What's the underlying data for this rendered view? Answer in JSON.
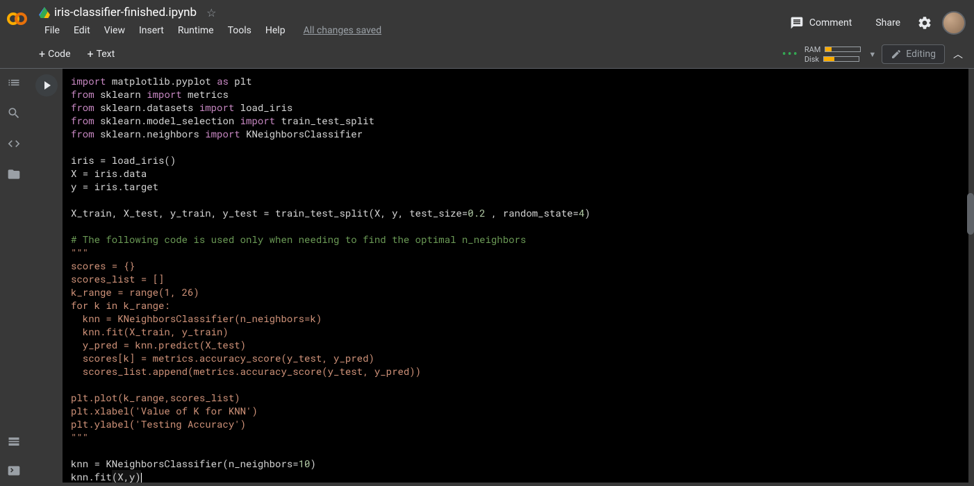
{
  "header": {
    "filename": "iris-classifier-finished.ipynb",
    "menu": {
      "file": "File",
      "edit": "Edit",
      "view": "View",
      "insert": "Insert",
      "runtime": "Runtime",
      "tools": "Tools",
      "help": "Help",
      "saved": "All changes saved"
    },
    "comment": "Comment",
    "share": "Share"
  },
  "toolbar": {
    "code": "Code",
    "text": "Text",
    "ram": "RAM",
    "disk": "Disk",
    "editing": "Editing"
  },
  "resources": {
    "ram_pct": 18,
    "disk_pct": 30
  },
  "code": {
    "lines": [
      {
        "t": "import",
        "k": "kw"
      },
      {
        "t": " matplotlib.pyplot "
      },
      {
        "t": "as",
        "k": "kw"
      },
      {
        "t": " plt"
      },
      {
        "br": true
      },
      {
        "t": "from",
        "k": "kw"
      },
      {
        "t": " sklearn "
      },
      {
        "t": "import",
        "k": "kw"
      },
      {
        "t": " metrics"
      },
      {
        "br": true
      },
      {
        "t": "from",
        "k": "kw"
      },
      {
        "t": " sklearn.datasets "
      },
      {
        "t": "import",
        "k": "kw"
      },
      {
        "t": " load_iris"
      },
      {
        "br": true
      },
      {
        "t": "from",
        "k": "kw"
      },
      {
        "t": " sklearn.model_selection "
      },
      {
        "t": "import",
        "k": "kw"
      },
      {
        "t": " train_test_split"
      },
      {
        "br": true
      },
      {
        "t": "from",
        "k": "kw"
      },
      {
        "t": " sklearn.neighbors "
      },
      {
        "t": "import",
        "k": "kw"
      },
      {
        "t": " KNeighborsClassifier"
      },
      {
        "br": true
      },
      {
        "br": true
      },
      {
        "t": "iris = load_iris()"
      },
      {
        "br": true
      },
      {
        "t": "X = iris.data"
      },
      {
        "br": true
      },
      {
        "t": "y = iris.target"
      },
      {
        "br": true
      },
      {
        "br": true
      },
      {
        "t": "X_train, X_test, y_train, y_test = train_test_split(X, y, test_size="
      },
      {
        "t": "0.2",
        "k": "num"
      },
      {
        "t": " , random_state="
      },
      {
        "t": "4",
        "k": "num"
      },
      {
        "t": ")"
      },
      {
        "br": true
      },
      {
        "br": true
      },
      {
        "t": "# The following code is used only when needing to find the optimal n_neighbors",
        "k": "comment"
      },
      {
        "br": true
      },
      {
        "t": "\"\"\"",
        "k": "str"
      },
      {
        "br": true
      },
      {
        "t": "scores = {}",
        "k": "str"
      },
      {
        "br": true
      },
      {
        "t": "scores_list = []",
        "k": "str"
      },
      {
        "br": true
      },
      {
        "t": "k_range = range(1, 26)",
        "k": "str"
      },
      {
        "br": true
      },
      {
        "t": "for k in k_range:",
        "k": "str"
      },
      {
        "br": true
      },
      {
        "t": "  knn = KNeighborsClassifier(n_neighbors=k)",
        "k": "str"
      },
      {
        "br": true
      },
      {
        "t": "  knn.fit(X_train, y_train)",
        "k": "str"
      },
      {
        "br": true
      },
      {
        "t": "  y_pred = knn.predict(X_test)",
        "k": "str"
      },
      {
        "br": true
      },
      {
        "t": "  scores[k] = metrics.accuracy_score(y_test, y_pred)",
        "k": "str"
      },
      {
        "br": true
      },
      {
        "t": "  scores_list.append(metrics.accuracy_score(y_test, y_pred))",
        "k": "str"
      },
      {
        "br": true
      },
      {
        "br": true
      },
      {
        "t": "plt.plot(k_range,scores_list)",
        "k": "str"
      },
      {
        "br": true
      },
      {
        "t": "plt.xlabel('Value of K for KNN')",
        "k": "str"
      },
      {
        "br": true
      },
      {
        "t": "plt.ylabel('Testing Accuracy')",
        "k": "str"
      },
      {
        "br": true
      },
      {
        "t": "\"\"\"",
        "k": "str"
      },
      {
        "br": true
      },
      {
        "br": true
      },
      {
        "t": "knn = KNeighborsClassifier(n_neighbors="
      },
      {
        "t": "10",
        "k": "num"
      },
      {
        "t": ")"
      },
      {
        "br": true
      },
      {
        "t": "knn.fit"
      },
      {
        "t": "(X,y)",
        "hl": true
      }
    ]
  }
}
